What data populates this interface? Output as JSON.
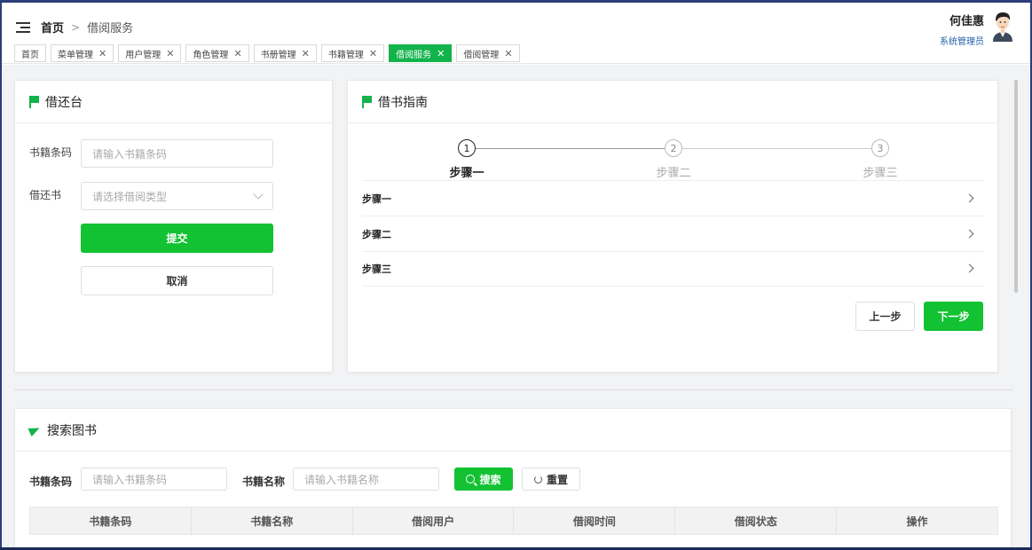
{
  "header": {
    "breadcrumb_home": "首页",
    "breadcrumb_sep": ">",
    "breadcrumb_current": "借阅服务",
    "user_name": "何佳惠",
    "user_role": "系统管理员"
  },
  "tabs": [
    {
      "label": "首页",
      "closable": false,
      "active": false
    },
    {
      "label": "菜单管理",
      "closable": true,
      "active": false
    },
    {
      "label": "用户管理",
      "closable": true,
      "active": false
    },
    {
      "label": "角色管理",
      "closable": true,
      "active": false
    },
    {
      "label": "书册管理",
      "closable": true,
      "active": false
    },
    {
      "label": "书籍管理",
      "closable": true,
      "active": false
    },
    {
      "label": "借阅服务",
      "closable": true,
      "active": true
    },
    {
      "label": "借阅管理",
      "closable": true,
      "active": false
    }
  ],
  "tab_close_glyph": "✕",
  "borrow": {
    "title": "借还台",
    "barcode_label": "书籍条码",
    "barcode_placeholder": "请输入书籍条码",
    "type_label": "借还书",
    "type_placeholder": "请选择借阅类型",
    "submit": "提交",
    "cancel": "取消"
  },
  "guide": {
    "title": "借书指南",
    "steps": [
      {
        "num": "1",
        "title": "步骤一",
        "active": true
      },
      {
        "num": "2",
        "title": "步骤二",
        "active": false
      },
      {
        "num": "3",
        "title": "步骤三",
        "active": false
      }
    ],
    "panels": [
      "步骤一",
      "步骤二",
      "步骤三"
    ],
    "prev": "上一步",
    "next": "下一步"
  },
  "search": {
    "title": "搜索图书",
    "barcode_label": "书籍条码",
    "barcode_placeholder": "请输入书籍条码",
    "name_label": "书籍名称",
    "name_placeholder": "请输入书籍名称",
    "search_btn": "搜索",
    "reset_btn": "重置",
    "columns": [
      "书籍条码",
      "书籍名称",
      "借阅用户",
      "借阅时间",
      "借阅状态",
      "操作"
    ]
  },
  "colors": {
    "accent": "#12c233",
    "active_tab": "#12b34a",
    "role_text": "#1f5fa8"
  }
}
